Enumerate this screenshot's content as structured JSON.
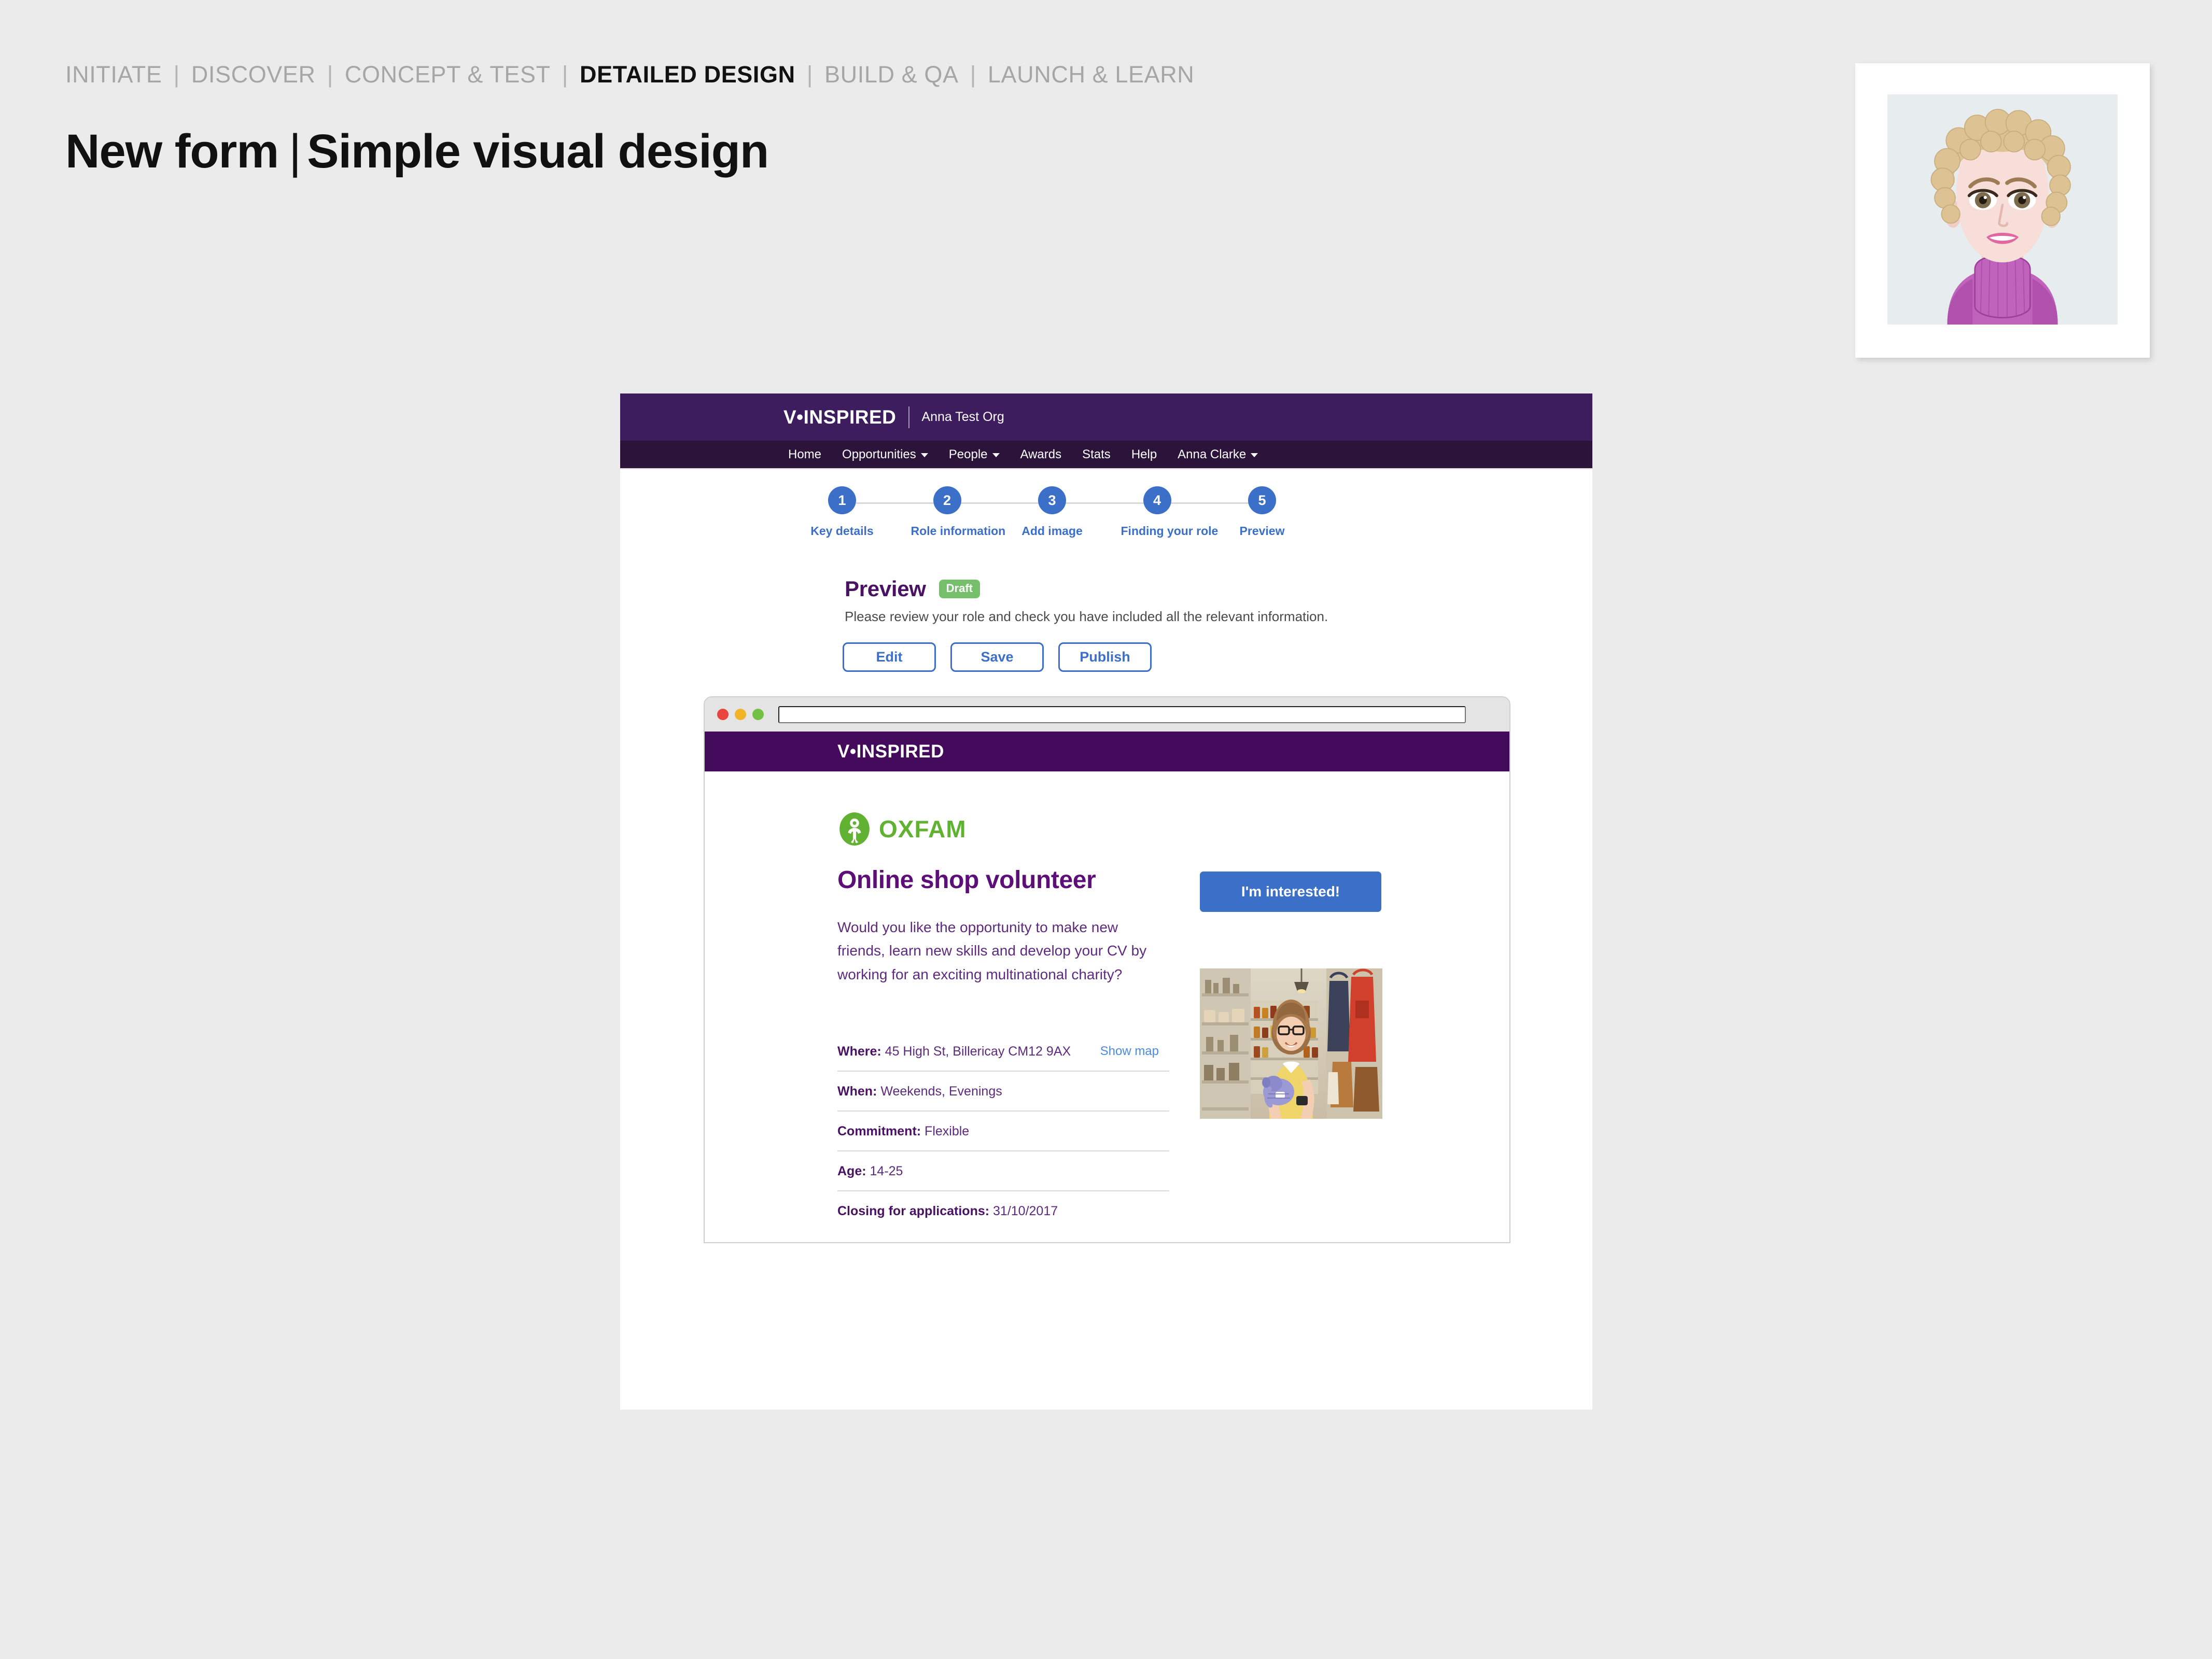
{
  "deck": {
    "phases": [
      {
        "label": "INITIATE",
        "active": false
      },
      {
        "label": "DISCOVER",
        "active": false
      },
      {
        "label": "CONCEPT & TEST",
        "active": false
      },
      {
        "label": "DETAILED DESIGN",
        "active": true
      },
      {
        "label": "BUILD & QA",
        "active": false
      },
      {
        "label": "LAUNCH & LEARN",
        "active": false
      }
    ],
    "separator": "|",
    "title_left": "New form",
    "title_bar": "|",
    "title_right": "Simple visual design"
  },
  "avatar": {
    "alt": "Cartoon portrait of a woman with short curly blonde hair wearing a purple turtleneck",
    "colors": {
      "background": "#e7ecee",
      "hair": "#ddc294",
      "skin": "#f6dcd7",
      "sweater": "#c063bd",
      "lips": "#e0689f",
      "eyes": "#7b6a4c"
    }
  },
  "app": {
    "brand": {
      "logo": "V•INSPIRED",
      "org": "Anna Test Org"
    },
    "nav": [
      {
        "label": "Home",
        "caret": false
      },
      {
        "label": "Opportunities",
        "caret": true
      },
      {
        "label": "People",
        "caret": true
      },
      {
        "label": "Awards",
        "caret": false
      },
      {
        "label": "Stats",
        "caret": false
      },
      {
        "label": "Help",
        "caret": false
      },
      {
        "label": "Anna Clarke",
        "caret": true
      }
    ],
    "stepper": {
      "steps": [
        {
          "number": "1",
          "label": "Key details"
        },
        {
          "number": "2",
          "label": "Role information"
        },
        {
          "number": "3",
          "label": "Add image"
        },
        {
          "number": "4",
          "label": "Finding your role"
        },
        {
          "number": "5",
          "label": "Preview"
        }
      ]
    },
    "preview": {
      "title": "Preview",
      "status_badge": "Draft",
      "subtitle": "Please review your role and check you have included all the relevant information.",
      "buttons": [
        {
          "label": "Edit"
        },
        {
          "label": "Save"
        },
        {
          "label": "Publish"
        }
      ]
    }
  },
  "browser": {
    "url_value": "",
    "url_placeholder": "",
    "site_logo": "V•INSPIRED",
    "listing": {
      "org_name": "OXFAM",
      "role_title": "Online shop volunteer",
      "cta_label": "I'm interested!",
      "description": "Would you like the opportunity to make new friends, learn new skills and develop your CV by working for an exciting multinational charity?",
      "photo_alt": "Smiling volunteer holding a knitted toy elephant inside a charity shop",
      "details": [
        {
          "label": "Where:",
          "value": "45 High St, Billericay CM12 9AX",
          "link": "Show map"
        },
        {
          "label": "When:",
          "value": "Weekends, Evenings",
          "link": ""
        },
        {
          "label": "Commitment:",
          "value": "Flexible",
          "link": ""
        },
        {
          "label": "Age:",
          "value": "14-25",
          "link": ""
        },
        {
          "label": "Closing for applications:",
          "value": "31/10/2017",
          "link": ""
        }
      ]
    }
  },
  "colors": {
    "page_background": "#ebebeb",
    "brand_purple": "#3e1d5e",
    "nav_purple": "#2b1339",
    "site_purple": "#440a5c",
    "accent_blue": "#3c6fc8",
    "draft_green": "#75bf6b",
    "oxfam_green": "#61b233",
    "heading_purple": "#4a1262",
    "link_blue": "#4a8bdf"
  }
}
